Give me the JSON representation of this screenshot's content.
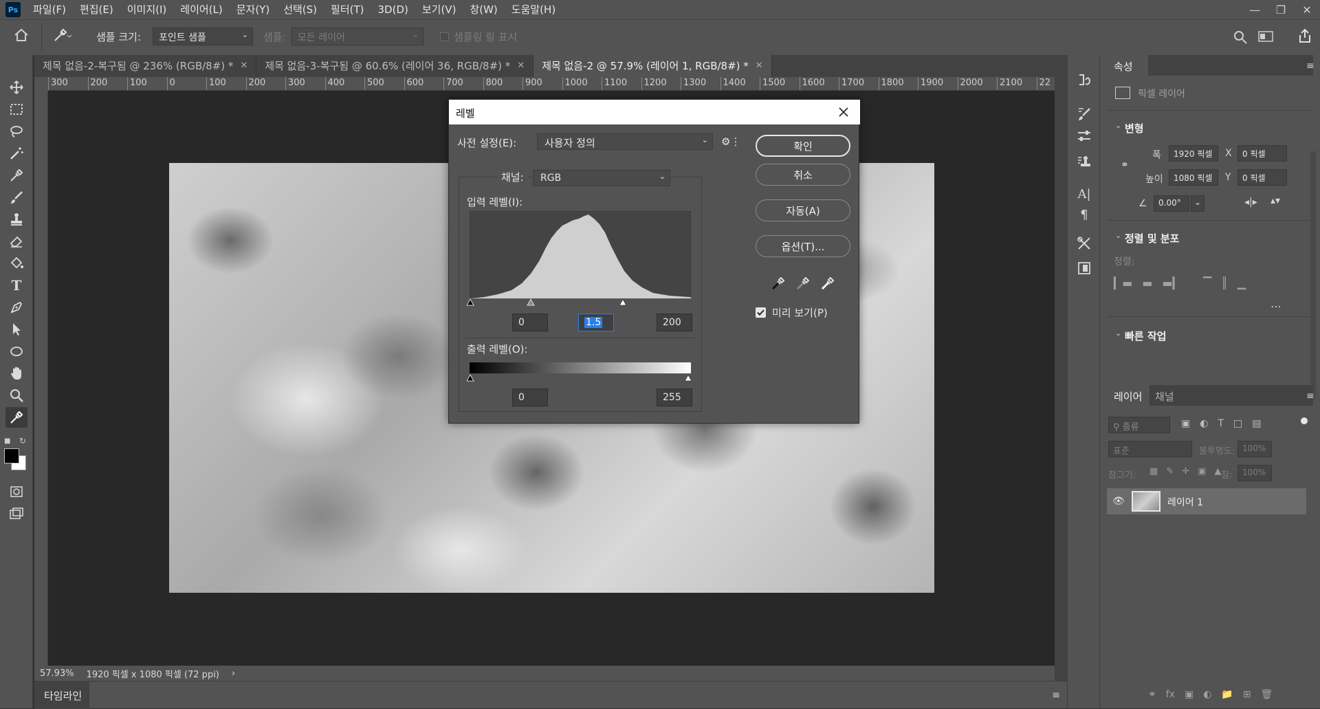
{
  "app": {
    "logo": "Ps"
  },
  "menu": [
    "파일(F)",
    "편집(E)",
    "이미지(I)",
    "레이어(L)",
    "문자(Y)",
    "선택(S)",
    "필터(T)",
    "3D(D)",
    "보기(V)",
    "창(W)",
    "도움말(H)"
  ],
  "options": {
    "sample_size_label": "샘플 크기:",
    "sample_size_value": "포인트 샘플",
    "sample_label": "샘플:",
    "sample_value": "모든 레이어",
    "show_ring": "샘플링 링 표시"
  },
  "tabs": [
    {
      "label": "제목 없음-2-복구됨 @ 236% (RGB/8#) *"
    },
    {
      "label": "제목 없음-3-복구됨 @ 60.6% (레이어 36, RGB/8#) *"
    },
    {
      "label": "제목 없음-2 @ 57.9% (레이어 1, RGB/8#) *"
    }
  ],
  "ruler_ticks": [
    "300",
    "200",
    "100",
    "0",
    "100",
    "200",
    "300",
    "400",
    "500",
    "600",
    "700",
    "800",
    "900",
    "1000",
    "1100",
    "1200",
    "1300",
    "1400",
    "1500",
    "1600",
    "1700",
    "1800",
    "1900",
    "2000",
    "2100",
    "22"
  ],
  "status": {
    "zoom": "57.93%",
    "dims": "1920 픽셀 x 1080 픽셀 (72 ppi)"
  },
  "timeline": {
    "label": "타임라인"
  },
  "properties": {
    "tab": "속성",
    "layer_type": "픽셀 레이어",
    "transform_title": "변형",
    "width_label": "폭",
    "width_value": "1920 픽셀",
    "height_label": "높이",
    "height_value": "1080 픽셀",
    "x_label": "X",
    "x_value": "0 픽셀",
    "y_label": "Y",
    "y_value": "0 픽셀",
    "angle_value": "0.00°",
    "align_title": "정렬 및 분포",
    "align_label": "정렬:",
    "quick_title": "빠른 작업"
  },
  "layers": {
    "tab_layers": "레이어",
    "tab_channels": "채널",
    "kind_label": "종류",
    "blend_mode": "표준",
    "opacity_label": "불투명도:",
    "opacity_value": "100%",
    "lock_label": "잠그기:",
    "fill_label": "칠:",
    "fill_value": "100%",
    "items": [
      {
        "name": "레이어 1"
      }
    ]
  },
  "levels": {
    "title": "레벨",
    "preset_label": "사전 설정(E):",
    "preset_value": "사용자 정의",
    "channel_label": "채널:",
    "channel_value": "RGB",
    "input_label": "입력 레벨(I):",
    "input_black": "0",
    "input_gamma": "1.5",
    "input_white": "200",
    "output_label": "출력 레벨(O):",
    "output_black": "0",
    "output_white": "255",
    "btn_ok": "확인",
    "btn_cancel": "취소",
    "btn_auto": "자동(A)",
    "btn_options": "옵션(T)...",
    "preview_label": "미리 보기(P)",
    "preview_checked": true
  }
}
